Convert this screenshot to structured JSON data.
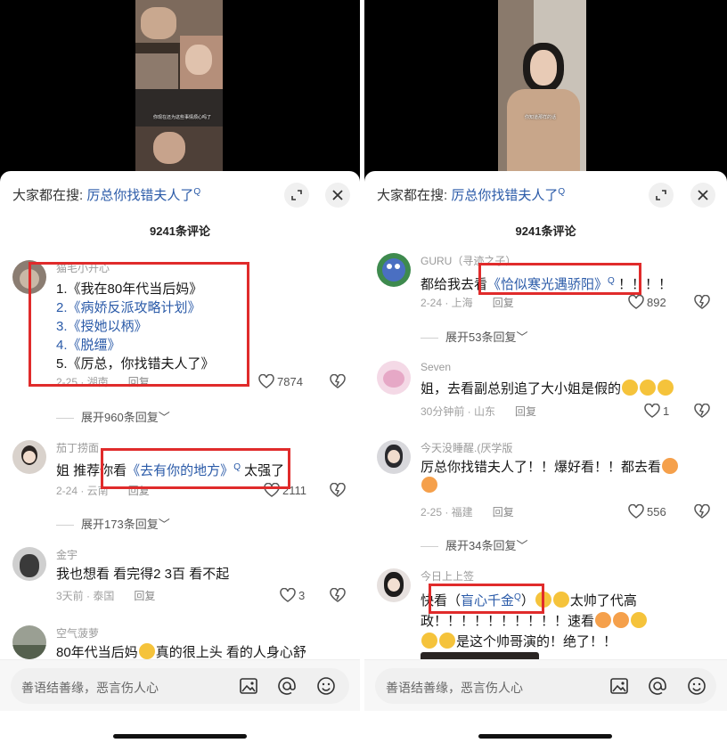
{
  "left": {
    "video_subtitle": "你现在还为这些事情烦心吗了",
    "search_prefix": "大家都在搜:",
    "search_term": "厉总你找错夫人了",
    "comment_count": "9241条评论",
    "comments": [
      {
        "username": "猫毛小开心",
        "lines": [
          "1.《我在80年代当后妈》",
          "2.《病娇反派攻略计划》",
          "3.《授她以柄》",
          "4.《脱缰》",
          "5.《厉总，你找错夫人了》"
        ],
        "meta": "2-25 · 湖南",
        "reply": "回复",
        "likes": "7874",
        "expand": "展开960条回复"
      },
      {
        "username": "茄丁捞面",
        "text_pre": "姐 推荐你看",
        "link": "《去有你的地方》",
        "text_post": "太强了",
        "meta": "2-24 · 云南",
        "reply": "回复",
        "likes": "2111",
        "expand": "展开173条回复"
      },
      {
        "username": "金宇",
        "text": "我也想看 看完得2 3百 看不起",
        "meta": "3天前 · 泰国",
        "reply": "回复",
        "likes": "3"
      },
      {
        "username": "空气菠萝",
        "text_pre": "80年代当后妈",
        "text_post": "真的很上头 看的人身心舒"
      }
    ],
    "input_placeholder": "善语结善缘，恶言伤人心"
  },
  "right": {
    "video_subtitle": "你知道那样的话",
    "search_prefix": "大家都在搜:",
    "search_term": "厉总你找错夫人了",
    "comment_count": "9241条评论",
    "comments": [
      {
        "username": "GURU（寻迹之子）",
        "text_pre": "都给我去看",
        "link": "《恰似寒光遇骄阳》",
        "text_post": "！！！！",
        "meta": "2-24 · 上海",
        "reply": "回复",
        "likes": "892",
        "expand": "展开53条回复"
      },
      {
        "username": "Seven",
        "text": "姐，去看副总别追了大小姐是假的",
        "meta": "30分钟前 · 山东",
        "reply": "回复",
        "likes": "1"
      },
      {
        "username": "今天没睡醒.(厌学版",
        "text": "厉总你找错夫人了！！爆好看！！都去看",
        "meta": "2-25 · 福建",
        "reply": "回复",
        "likes": "556",
        "expand": "展开34条回复"
      },
      {
        "username": "今日上上签",
        "text_pre": "快看（",
        "link": "盲心千金",
        "text_mid": "）",
        "text_mid2": "太帅了代高",
        "line2": "政！！！！！！！！！！速看",
        "line3": "是这个帅哥演的！绝了！！"
      }
    ],
    "input_placeholder": "善语结善缘，恶言伤人心"
  },
  "icons": [
    "expand-icon",
    "close-icon",
    "heart-icon",
    "dislike-heart-icon",
    "chevron-down-icon",
    "image-icon",
    "at-icon",
    "smile-icon",
    "search-suffix-icon"
  ],
  "colors": {
    "link": "#2a5aa8",
    "highlight_box": "#e02b2b",
    "text": "#161616",
    "muted": "#a0a0a0"
  }
}
